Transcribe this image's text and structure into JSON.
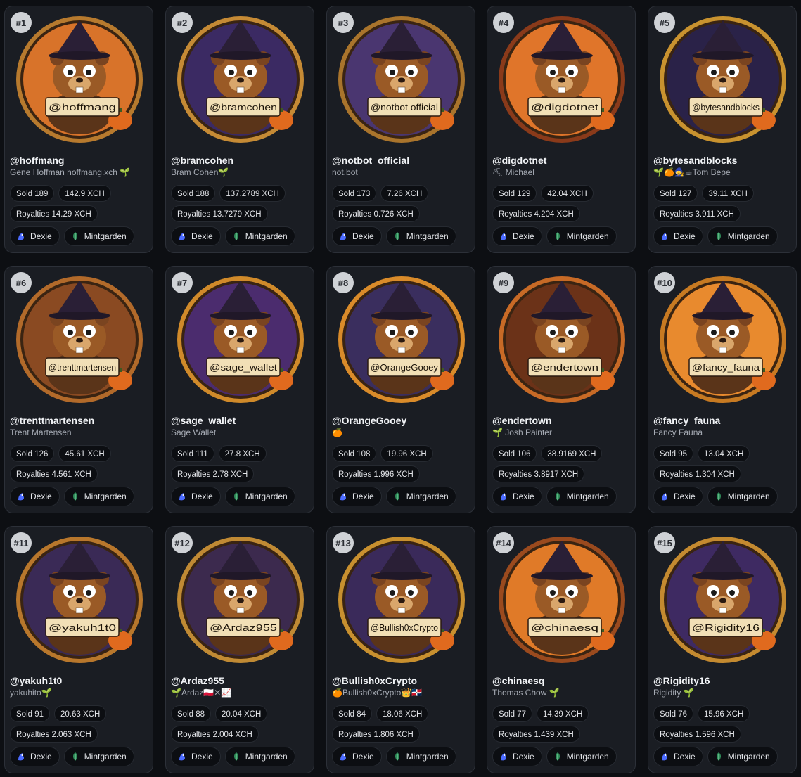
{
  "labels": {
    "sold_prefix": "Sold",
    "royalties_prefix": "Royalties",
    "dexie": "Dexie",
    "mintgarden": "Mintgarden"
  },
  "colors": {
    "card_bg": "#1a1d23",
    "card_border": "#2c3038",
    "pill_bg": "#0c0e12",
    "rank_badge": "#cfd2d6",
    "dexie_icon": "#4b6bff",
    "mintgarden_icon": "#2f8f5a"
  },
  "cards": [
    {
      "rank": "#1",
      "handle": "@hoffmang",
      "subtitle": "Gene Hoffman hoffmang.xch 🌱",
      "sold": "Sold 189",
      "volume": "142.9 XCH",
      "royalties": "Royalties 14.29 XCH",
      "art_label": "@hoffmang",
      "art_bg": "#d8732a",
      "art_ring": "#b77a2e"
    },
    {
      "rank": "#2",
      "handle": "@bramcohen",
      "subtitle": "Bram Cohen🌱",
      "sold": "Sold 188",
      "volume": "137.2789 XCH",
      "royalties": "Royalties 13.7279 XCH",
      "art_label": "@bramcohen",
      "art_bg": "#3b2a63",
      "art_ring": "#c58a35"
    },
    {
      "rank": "#3",
      "handle": "@notbot_official",
      "subtitle": "not.bot",
      "sold": "Sold 173",
      "volume": "7.26 XCH",
      "royalties": "Royalties 0.726 XCH",
      "art_label": "@notbot official",
      "art_bg": "#4a3670",
      "art_ring": "#a9742c"
    },
    {
      "rank": "#4",
      "handle": "@digdotnet",
      "subtitle": "⛏ Michael",
      "sold": "Sold 129",
      "volume": "42.04 XCH",
      "royalties": "Royalties 4.204 XCH",
      "art_label": "@digdotnet",
      "art_bg": "#e0752a",
      "art_ring": "#8a3a1a"
    },
    {
      "rank": "#5",
      "handle": "@bytesandblocks",
      "subtitle": "🌱🍊🧙☕Tom Bepe",
      "sold": "Sold 127",
      "volume": "39.11 XCH",
      "royalties": "Royalties 3.911 XCH",
      "art_label": "@bytesandblocks",
      "art_bg": "#2a2248",
      "art_ring": "#c8922f"
    },
    {
      "rank": "#6",
      "handle": "@trenttmartensen",
      "subtitle": "Trent Martensen",
      "sold": "Sold 126",
      "volume": "45.61 XCH",
      "royalties": "Royalties 4.561 XCH",
      "art_label": "@trenttmartensen",
      "art_bg": "#8a4a22",
      "art_ring": "#b26a2a"
    },
    {
      "rank": "#7",
      "handle": "@sage_wallet",
      "subtitle": "Sage Wallet",
      "sold": "Sold 111",
      "volume": "27.8 XCH",
      "royalties": "Royalties 2.78 XCH",
      "art_label": "@sage_wallet",
      "art_bg": "#4b2c6e",
      "art_ring": "#d08a2a"
    },
    {
      "rank": "#8",
      "handle": "@OrangeGooey",
      "subtitle": "🍊",
      "sold": "Sold 108",
      "volume": "19.96 XCH",
      "royalties": "Royalties 1.996 XCH",
      "art_label": "@OrangeGooey",
      "art_bg": "#3a2e5e",
      "art_ring": "#d98b2a"
    },
    {
      "rank": "#9",
      "handle": "@endertown",
      "subtitle": "🌱 Josh Painter",
      "sold": "Sold 106",
      "volume": "38.9169 XCH",
      "royalties": "Royalties 3.8917 XCH",
      "art_label": "@endertown",
      "art_bg": "#6b3218",
      "art_ring": "#c76a26"
    },
    {
      "rank": "#10",
      "handle": "@fancy_fauna",
      "subtitle": "Fancy Fauna",
      "sold": "Sold 95",
      "volume": "13.04 XCH",
      "royalties": "Royalties 1.304 XCH",
      "art_label": "@fancy_fauna",
      "art_bg": "#e88a2e",
      "art_ring": "#c77a22"
    },
    {
      "rank": "#11",
      "handle": "@yakuh1t0",
      "subtitle": "yakuhito🌱",
      "sold": "Sold 91",
      "volume": "20.63 XCH",
      "royalties": "Royalties 2.063 XCH",
      "art_label": "@yakuh1t0",
      "art_bg": "#3a2a56",
      "art_ring": "#b8772c"
    },
    {
      "rank": "#12",
      "handle": "@Ardaz955",
      "subtitle": "🌱Ardaz🇵🇱✕📈",
      "sold": "Sold 88",
      "volume": "20.04 XCH",
      "royalties": "Royalties 2.004 XCH",
      "art_label": "@Ardaz955",
      "art_bg": "#3c2a4e",
      "art_ring": "#c08a34"
    },
    {
      "rank": "#13",
      "handle": "@Bullish0xCrypto",
      "subtitle": "🍊Bullish0xCrypto👑🇩🇴",
      "sold": "Sold 84",
      "volume": "18.06 XCH",
      "royalties": "Royalties 1.806 XCH",
      "art_label": "@Bullish0xCrypto",
      "art_bg": "#3a2a5a",
      "art_ring": "#c8902f"
    },
    {
      "rank": "#14",
      "handle": "@chinaesq",
      "subtitle": "Thomas Chow 🌱",
      "sold": "Sold 77",
      "volume": "14.39 XCH",
      "royalties": "Royalties 1.439 XCH",
      "art_label": "@chinaesq",
      "art_bg": "#e07a28",
      "art_ring": "#9a4a1e"
    },
    {
      "rank": "#15",
      "handle": "@Rigidity16",
      "subtitle": "Rigidity 🌱",
      "sold": "Sold 76",
      "volume": "15.96 XCH",
      "royalties": "Royalties 1.596 XCH",
      "art_label": "@Rigidity16",
      "art_bg": "#3e2a62",
      "art_ring": "#c48a30"
    }
  ]
}
